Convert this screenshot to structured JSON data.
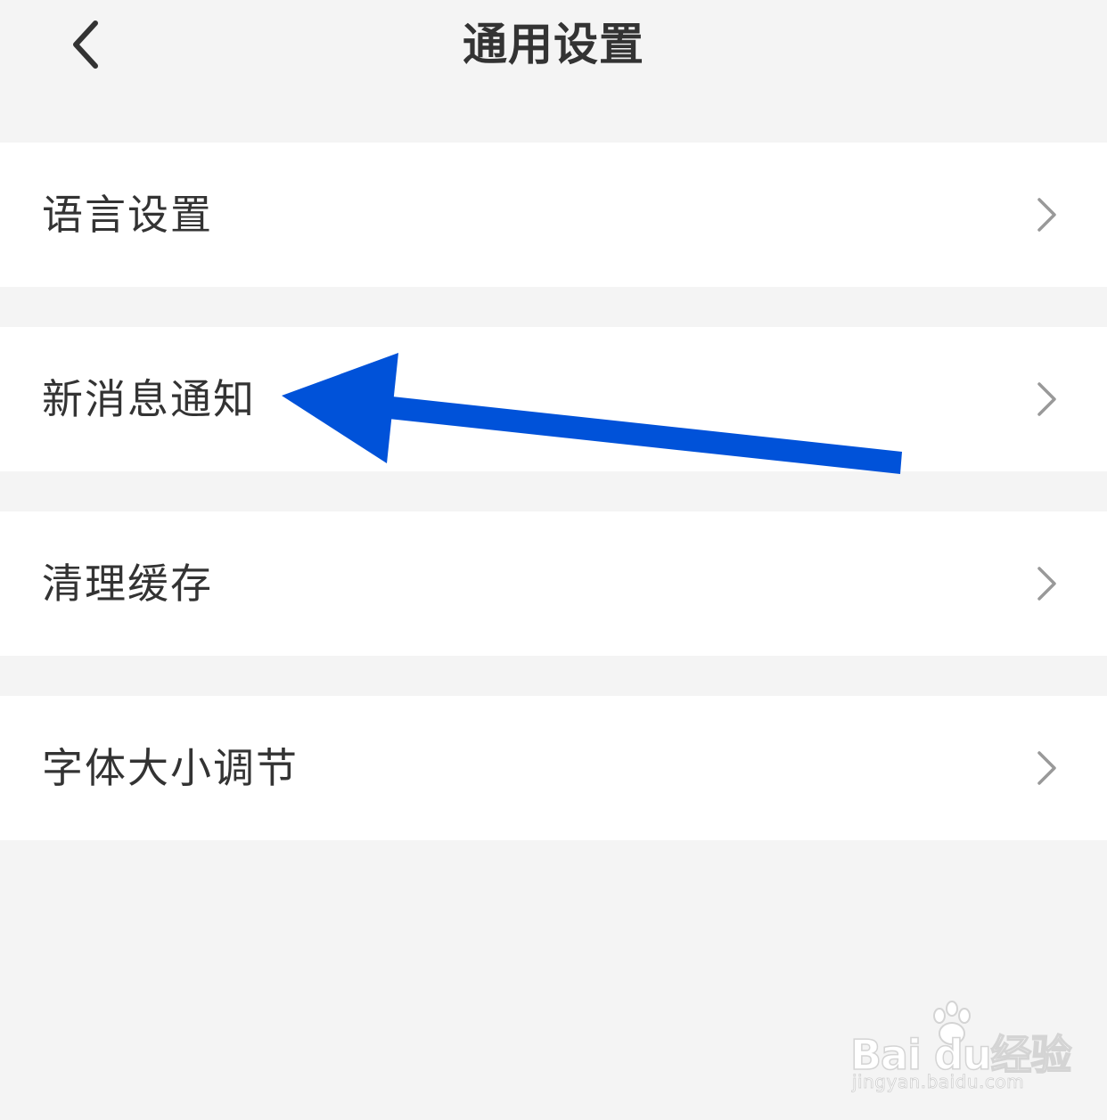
{
  "header": {
    "title": "通用设置",
    "back_icon": "chevron-left-icon"
  },
  "settings": {
    "items": [
      {
        "label": "语言设置",
        "icon": "chevron-right-icon"
      },
      {
        "label": "新消息通知",
        "icon": "chevron-right-icon"
      },
      {
        "label": "清理缓存",
        "icon": "chevron-right-icon"
      },
      {
        "label": "字体大小调节",
        "icon": "chevron-right-icon"
      }
    ]
  },
  "annotation": {
    "type": "arrow",
    "color": "#0052d9",
    "points_to": "新消息通知"
  },
  "watermark": {
    "brand": "Bai du经验",
    "url": "jingyan.baidu.com"
  },
  "colors": {
    "background": "#f4f4f4",
    "row_background": "#ffffff",
    "text": "#333333",
    "chevron": "#999999",
    "arrow": "#0052d9"
  }
}
